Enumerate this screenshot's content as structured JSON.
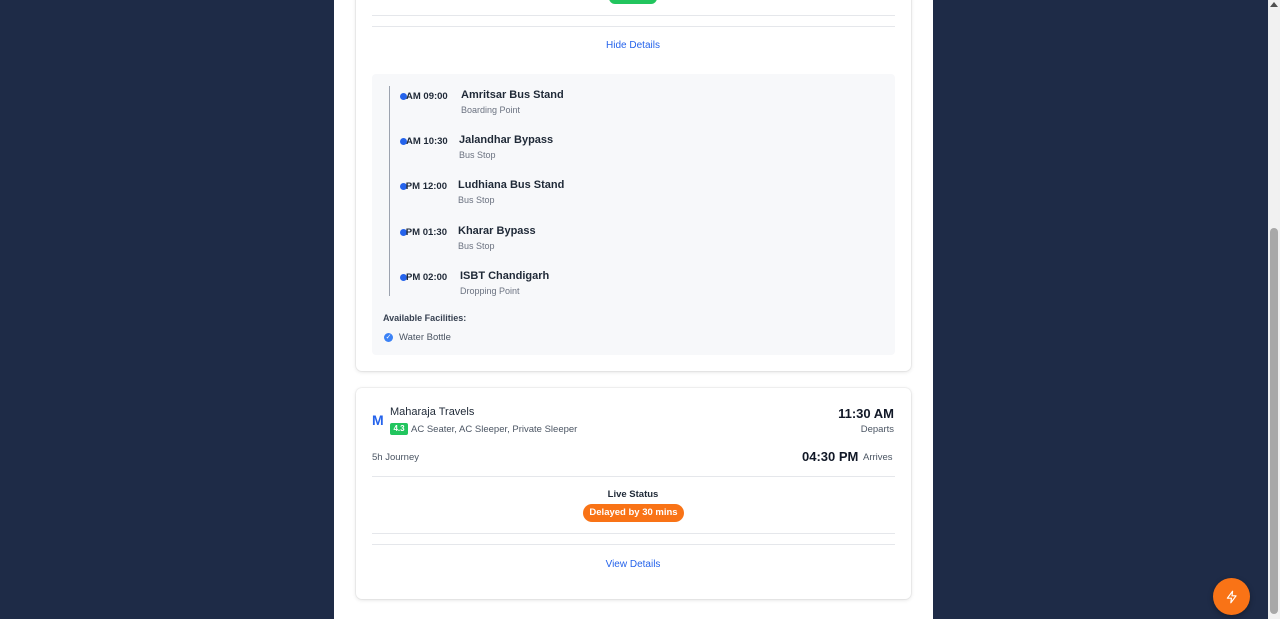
{
  "first_card": {
    "hide_details_label": "Hide Details",
    "stops": [
      {
        "time": "09:00 AM",
        "name": "Amritsar Bus Stand",
        "type": "Boarding Point"
      },
      {
        "time": "10:30 AM",
        "name": "Jalandhar Bypass",
        "type": "Bus Stop"
      },
      {
        "time": "12:00 PM",
        "name": "Ludhiana Bus Stand",
        "type": "Bus Stop"
      },
      {
        "time": "01:30 PM",
        "name": "Kharar Bypass",
        "type": "Bus Stop"
      },
      {
        "time": "02:00 PM",
        "name": "ISBT Chandigarh",
        "type": "Dropping Point"
      }
    ],
    "facilities_title": "Available Facilities:",
    "facilities": [
      "Water Bottle"
    ]
  },
  "second_card": {
    "logo_letter": "M",
    "operator": "Maharaja Travels",
    "rating": "4.3",
    "bus_types": "AC Seater, AC Sleeper, Private Sleeper",
    "departure_time": "11:30 AM",
    "departure_label": "Departs",
    "journey": "5h Journey",
    "arrival_time": "04:30 PM",
    "arrival_label": "Arrives",
    "live_status_title": "Live Status",
    "live_status": "Delayed by 30 mins",
    "view_details_label": "View Details"
  },
  "colors": {
    "background": "#1e2b47",
    "accent": "#2563eb",
    "success": "#22c55e",
    "warning": "#f97316"
  },
  "icons": {
    "fab": "lightning-icon",
    "facility": "check-circle-icon"
  }
}
